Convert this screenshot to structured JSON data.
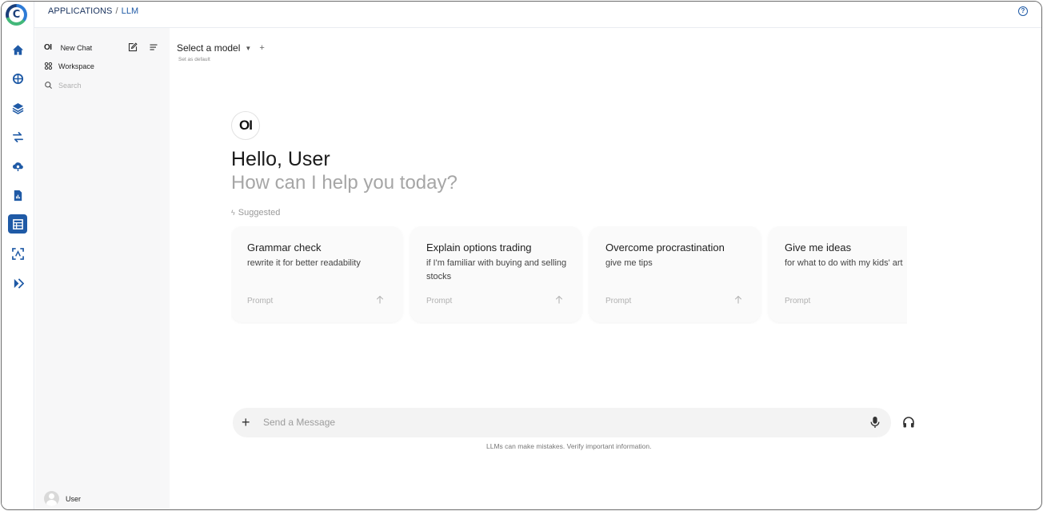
{
  "app": {
    "logo_letter": "C",
    "breadcrumb": {
      "parent": "APPLICATIONS",
      "separator": "/",
      "current": "LLM"
    },
    "help_glyph": "?"
  },
  "rail": {
    "items": [
      {
        "icon": "home-icon",
        "active": false
      },
      {
        "icon": "brain-icon",
        "active": false
      },
      {
        "icon": "layers-icon",
        "active": false
      },
      {
        "icon": "transfer-icon",
        "active": false
      },
      {
        "icon": "cloud-cog-icon",
        "active": false
      },
      {
        "icon": "report-icon",
        "active": false
      },
      {
        "icon": "apps-grid-icon",
        "active": true
      },
      {
        "icon": "scan-icon",
        "active": false
      },
      {
        "icon": "expand-icon",
        "active": false
      }
    ]
  },
  "sidebar": {
    "brand": "OI",
    "new_chat": "New Chat",
    "workspace": "Workspace",
    "search_placeholder": "Search",
    "user_name": "User"
  },
  "header": {
    "model_select": "Select a model",
    "plus": "+",
    "set_default": "Set as default"
  },
  "main": {
    "logo_text": "OI",
    "greeting": "Hello, User",
    "subtitle": "How can I help you today?",
    "suggested_label": "Suggested",
    "suggestions": [
      {
        "title": "Grammar check",
        "subtitle": "rewrite it for better readability",
        "prompt": "Prompt"
      },
      {
        "title": "Explain options trading",
        "subtitle": "if I'm familiar with buying and selling stocks",
        "prompt": "Prompt"
      },
      {
        "title": "Overcome procrastination",
        "subtitle": "give me tips",
        "prompt": "Prompt"
      },
      {
        "title": "Give me ideas",
        "subtitle": "for what to do with my kids' art",
        "prompt": "Prompt"
      }
    ]
  },
  "composer": {
    "plus": "+",
    "placeholder": "Send a Message",
    "disclaimer": "LLMs can make mistakes. Verify important information."
  },
  "colors": {
    "accent": "#1f5aa6",
    "sidebar_bg": "#f7f7f8"
  }
}
